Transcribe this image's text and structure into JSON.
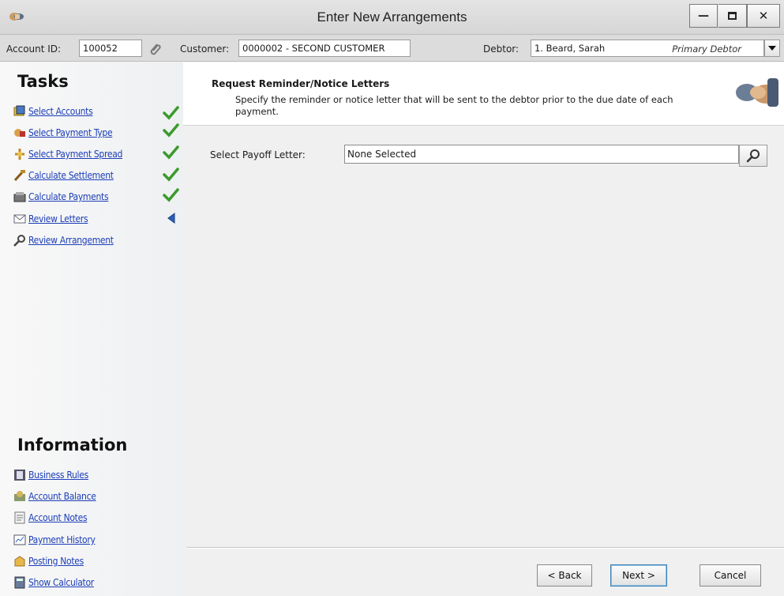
{
  "window": {
    "title": "Enter New Arrangements",
    "controls": [
      "minimize-icon",
      "maximize-icon",
      "close-icon"
    ]
  },
  "account_bar": {
    "account_id_label": "Account ID:",
    "account_id_value": "100052",
    "customer_label": "Customer:",
    "customer_value": "0000002 - SECOND CUSTOMER",
    "debtor_label": "Debtor:",
    "debtor_value": "1. Beard, Sarah",
    "debtor_role": "Primary Debtor"
  },
  "tasks": {
    "title": "Tasks",
    "items": [
      {
        "label": "Select Accounts",
        "icon": "accounts-icon",
        "status": "complete"
      },
      {
        "label": "Select Payment Type",
        "icon": "payment-type-icon",
        "status": "complete"
      },
      {
        "label": "Select Payment Spread",
        "icon": "payment-spread-icon",
        "status": "complete"
      },
      {
        "label": "Calculate Settlement",
        "icon": "settlement-icon",
        "status": "complete"
      },
      {
        "label": "Calculate Payments",
        "icon": "payments-icon",
        "status": "complete"
      },
      {
        "label": "Review Letters",
        "icon": "letters-icon",
        "status": "current"
      },
      {
        "label": "Review Arrangement",
        "icon": "magnifier-icon",
        "status": "pending"
      }
    ]
  },
  "information": {
    "title": "Information",
    "items": [
      {
        "label": "Business Rules",
        "icon": "business-rules-icon"
      },
      {
        "label": "Account Balance",
        "icon": "account-balance-icon"
      },
      {
        "label": "Account Notes",
        "icon": "notes-icon"
      },
      {
        "label": "Payment History",
        "icon": "payment-history-icon"
      },
      {
        "label": "Posting Notes",
        "icon": "posting-notes-icon"
      },
      {
        "label": "Show Calculator",
        "icon": "calculator-icon"
      }
    ]
  },
  "main": {
    "header_title": "Request Reminder/Notice Letters",
    "header_desc": "Specify the reminder or notice letter that will be sent to the debtor prior to the due date of each payment.",
    "payoff_label": "Select Payoff Letter:",
    "payoff_value": "None Selected"
  },
  "buttons": {
    "back": "< Back",
    "next": "Next >",
    "cancel": "Cancel"
  },
  "colors": {
    "link": "#1d3fb8",
    "check": "#3a9b2a",
    "current_arrow": "#2b5fb6"
  }
}
